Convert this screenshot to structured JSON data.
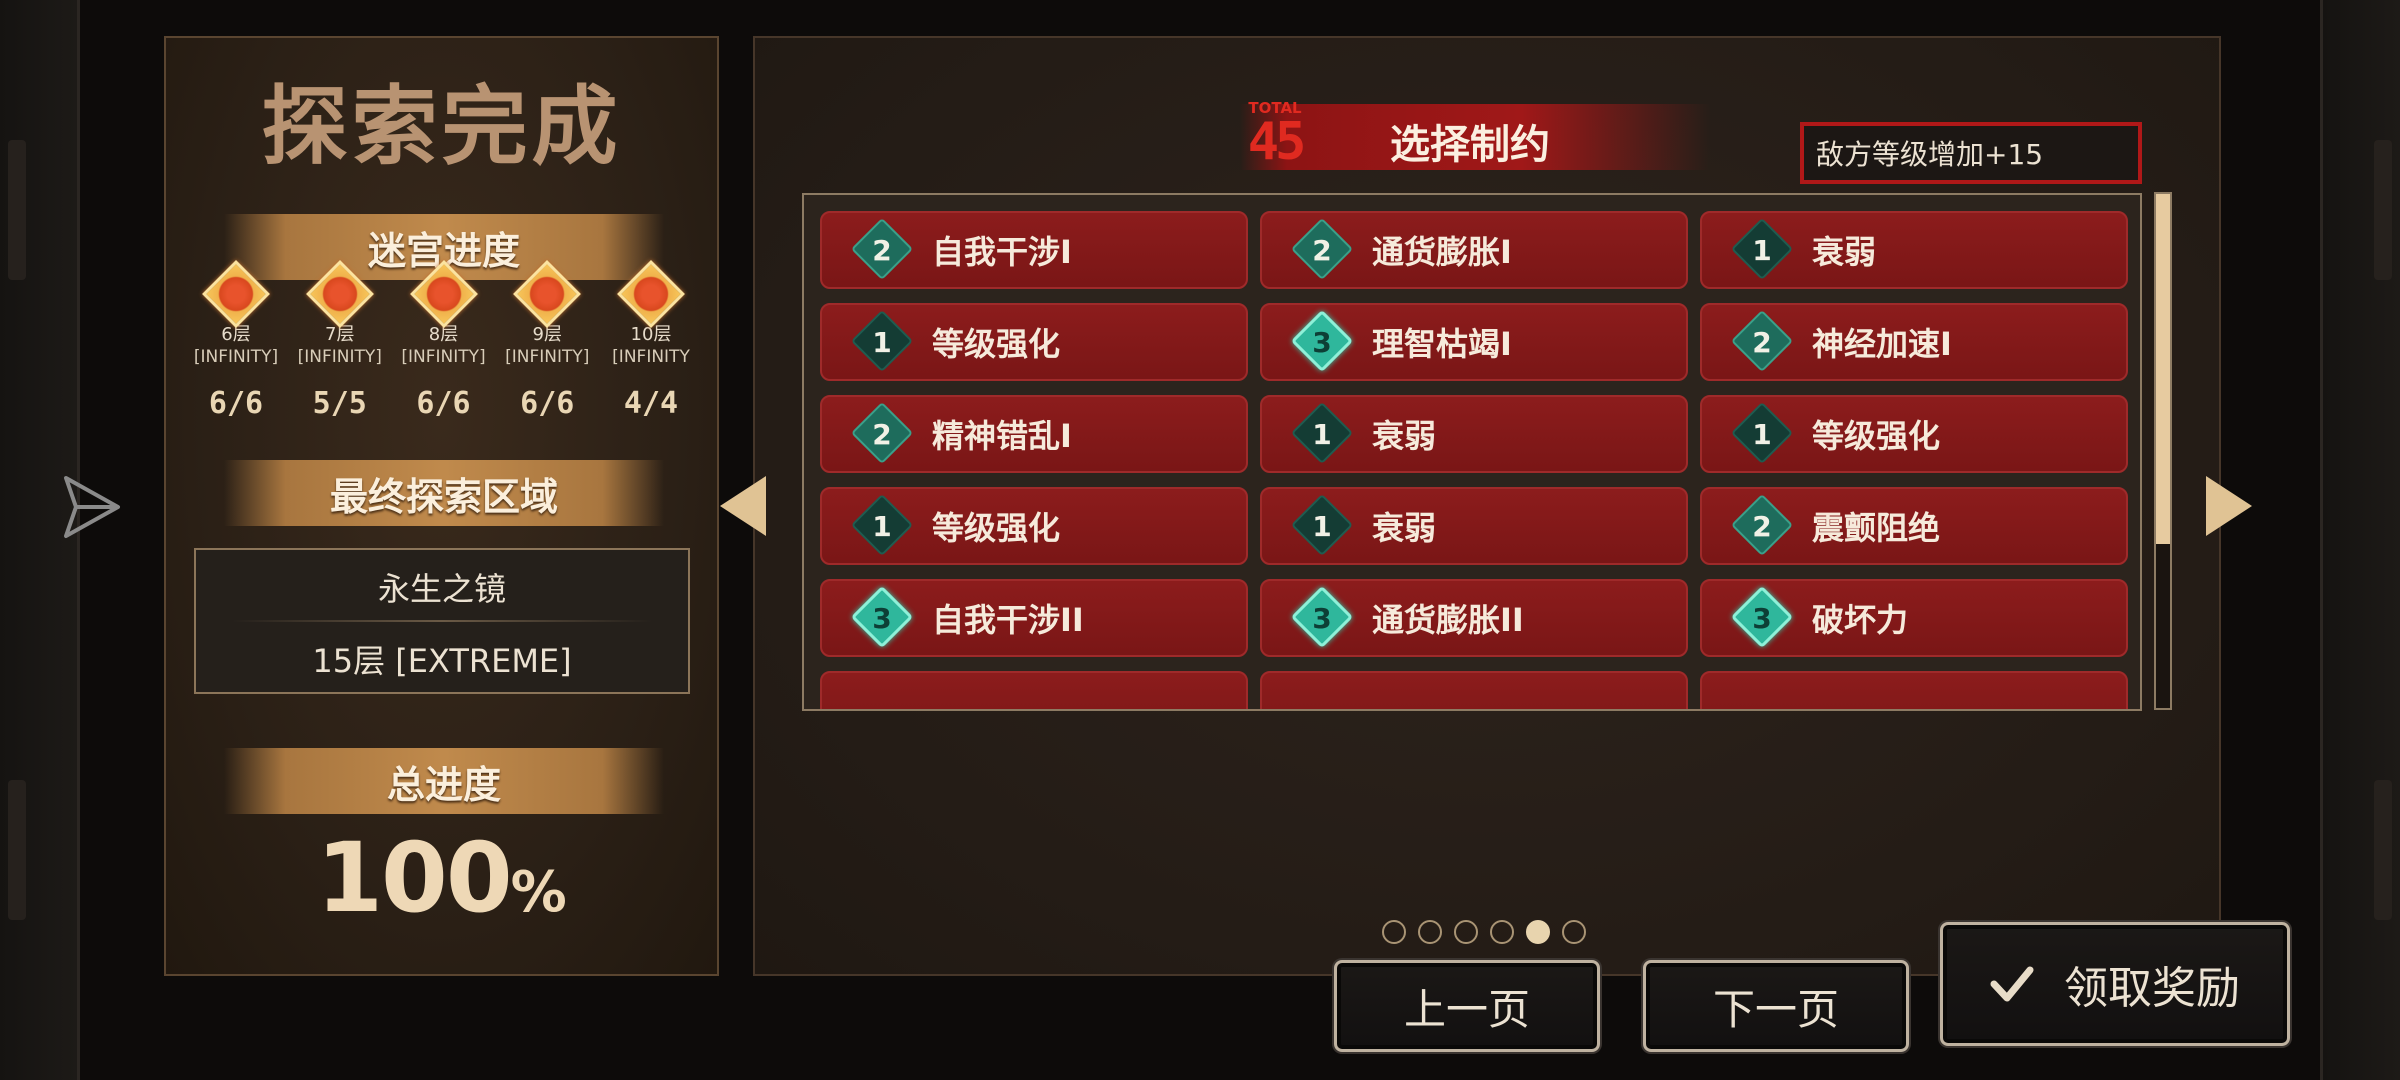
{
  "left": {
    "title": "探索完成",
    "progress_banner": "迷宫进度",
    "floors": [
      {
        "floor": "6层",
        "mode": "[INFINITY]",
        "count": "6/6"
      },
      {
        "floor": "7层",
        "mode": "[INFINITY]",
        "count": "5/5"
      },
      {
        "floor": "8层",
        "mode": "[INFINITY]",
        "count": "6/6"
      },
      {
        "floor": "9层",
        "mode": "[INFINITY]",
        "count": "6/6"
      },
      {
        "floor": "10层",
        "mode": "[INFINITY",
        "count": "4/4"
      }
    ],
    "final_area_banner": "最终探索区域",
    "final_area": {
      "name": "永生之镜",
      "level": "15层 [EXTREME]"
    },
    "total_banner": "总进度",
    "total_value": "100",
    "total_unit": "%"
  },
  "right": {
    "total_label": "TOTAL",
    "total_value": "45",
    "header_title": "选择制约",
    "enemy_bonus": "敌方等级增加+15",
    "constraints": [
      {
        "level": "2",
        "label": "自我干涉I"
      },
      {
        "level": "2",
        "label": "通货膨胀I"
      },
      {
        "level": "1",
        "label": "衰弱"
      },
      {
        "level": "1",
        "label": "等级强化"
      },
      {
        "level": "3",
        "label": "理智枯竭I"
      },
      {
        "level": "2",
        "label": "神经加速I"
      },
      {
        "level": "2",
        "label": "精神错乱I"
      },
      {
        "level": "1",
        "label": "衰弱"
      },
      {
        "level": "1",
        "label": "等级强化"
      },
      {
        "level": "1",
        "label": "等级强化"
      },
      {
        "level": "1",
        "label": "衰弱"
      },
      {
        "level": "2",
        "label": "震颤阻绝"
      },
      {
        "level": "3",
        "label": "自我干涉II"
      },
      {
        "level": "3",
        "label": "通货膨胀II"
      },
      {
        "level": "3",
        "label": "破坏力"
      }
    ],
    "scroll_fraction": 0.68,
    "pages": {
      "total": 6,
      "current": 5
    }
  },
  "buttons": {
    "prev": "上一页",
    "next": "下一页",
    "claim": "领取奖励"
  },
  "icons": [
    "share-icon",
    "arrow-left-icon",
    "arrow-right-icon",
    "check-icon",
    "floor-gem-icon",
    "level-diamond-icon"
  ],
  "colors": {
    "accent_red": "#8c1c1c",
    "teal": "#2fb79c",
    "banner_gold": "#c08a4c"
  }
}
